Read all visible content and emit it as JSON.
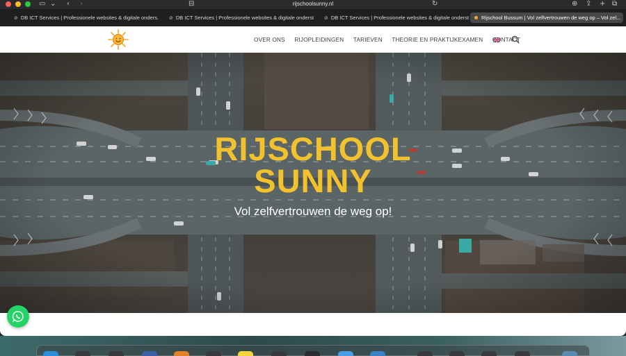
{
  "browser": {
    "url": "rijschoolsunny.nl",
    "tabs": [
      {
        "title": "DB ICT Services | Professionele websites & digitale onders...",
        "active": false
      },
      {
        "title": "DB ICT Services | Professionele websites & digitale onderst...",
        "active": false
      },
      {
        "title": "DB ICT Services | Professionele websites & digitale onderst...",
        "active": false
      },
      {
        "title": "Rijschool Bussum | Vol zelfvertrouwen de weg op – Vol zel...",
        "active": true
      }
    ]
  },
  "site": {
    "nav": {
      "items": [
        "OVER ONS",
        "RIJOPLEIDINGEN",
        "TARIEVEN",
        "THEORIE EN PRAKTIJKEXAMEN",
        "CONTACT"
      ]
    },
    "hero": {
      "title_line1": "RIJSCHOOL",
      "title_line2": "SUNNY",
      "subtitle": "Vol zelfvertrouwen de weg op!"
    }
  },
  "colors": {
    "accent_yellow": "#f2c12e",
    "whatsapp_green": "#25d366",
    "nav_text": "#3b3b3b"
  }
}
